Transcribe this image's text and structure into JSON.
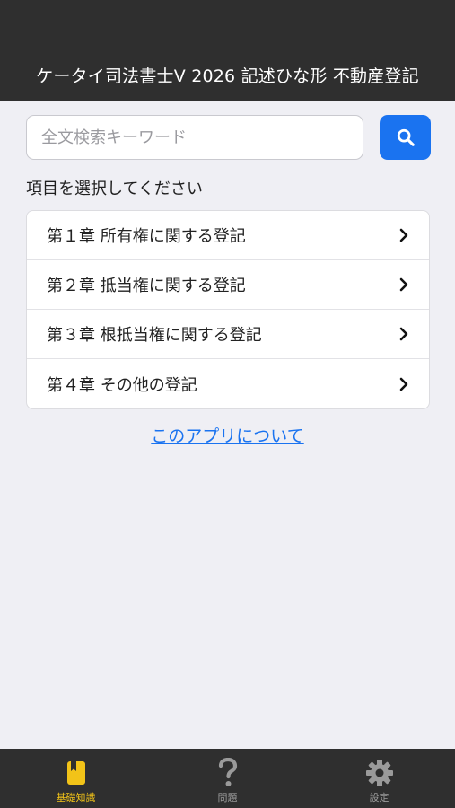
{
  "header": {
    "title": "ケータイ司法書士V 2026 記述ひな形 不動産登記"
  },
  "search": {
    "placeholder": "全文検索キーワード",
    "value": ""
  },
  "prompt": "項目を選択してください",
  "chapters": [
    {
      "label": "第１章 所有権に関する登記"
    },
    {
      "label": "第２章 抵当権に関する登記"
    },
    {
      "label": "第３章 根抵当権に関する登記"
    },
    {
      "label": "第４章 その他の登記"
    }
  ],
  "about_link": "このアプリについて",
  "tabbar": {
    "tabs": [
      {
        "label": "基礎知識",
        "icon": "book-icon",
        "active": true
      },
      {
        "label": "問題",
        "icon": "question-icon",
        "active": false
      },
      {
        "label": "設定",
        "icon": "gear-icon",
        "active": false
      }
    ]
  },
  "colors": {
    "accent": "#1a73f0",
    "active_tab": "#f2c318",
    "bar": "#2f2f2f",
    "background": "#efeff4"
  }
}
